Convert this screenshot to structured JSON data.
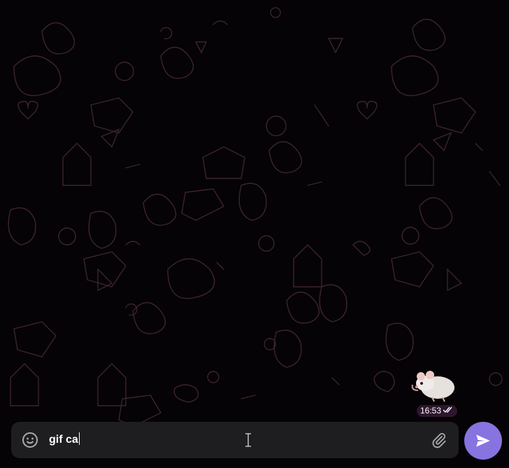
{
  "message": {
    "time": "16:53",
    "status": "read-double-check-icon",
    "sticker": "rat-sticker"
  },
  "composer": {
    "input_value": "gif ca",
    "emoji_icon": "smile-icon",
    "attach_icon": "paperclip-icon",
    "send_icon": "send-arrow-icon"
  },
  "colors": {
    "accent": "#8774e1",
    "composer_bg": "#1e1e20",
    "pattern": "#4a2a3e"
  }
}
